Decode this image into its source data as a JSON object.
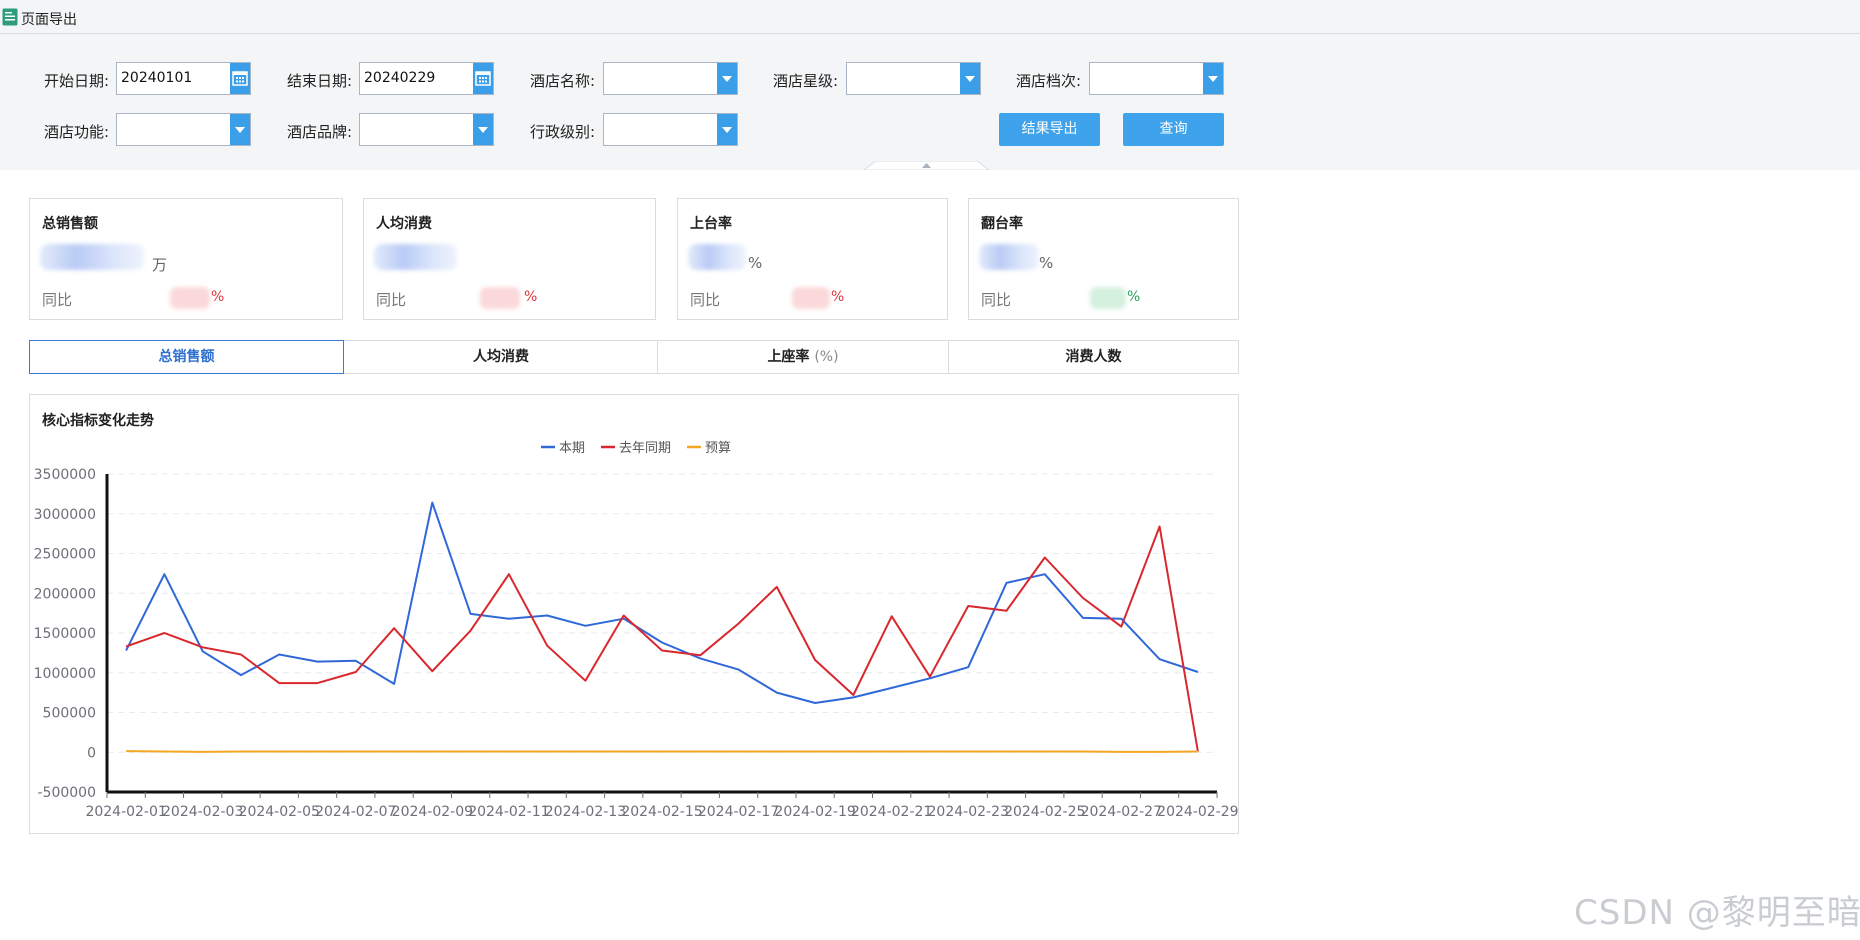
{
  "window": {
    "title": "页面导出"
  },
  "filters": {
    "start_date": {
      "label": "开始日期:",
      "value": "20240101"
    },
    "end_date": {
      "label": "结束日期:",
      "value": "20240229"
    },
    "hotel_name": {
      "label": "酒店名称:",
      "value": ""
    },
    "hotel_star": {
      "label": "酒店星级:",
      "value": ""
    },
    "hotel_grade": {
      "label": "酒店档次:",
      "value": ""
    },
    "hotel_function": {
      "label": "酒店功能:",
      "value": ""
    },
    "hotel_brand": {
      "label": "酒店品牌:",
      "value": ""
    },
    "admin_level": {
      "label": "行政级别:",
      "value": ""
    }
  },
  "actions": {
    "export_label": "结果导出",
    "query_label": "查询"
  },
  "cards": [
    {
      "title": "总销售额",
      "unit": "万",
      "yoy_label": "同比",
      "pct": "%",
      "trend_color": "#d9363e"
    },
    {
      "title": "人均消费",
      "unit": "",
      "yoy_label": "同比",
      "pct": "%",
      "trend_color": "#d9363e"
    },
    {
      "title": "上台率",
      "unit": "%",
      "yoy_label": "同比",
      "pct": "%",
      "trend_color": "#d9363e"
    },
    {
      "title": "翻台率",
      "unit": "%",
      "yoy_label": "同比",
      "pct": "%",
      "trend_color": "#27a55a"
    }
  ],
  "tabs": [
    {
      "label": "总销售额",
      "suffix": ""
    },
    {
      "label": "人均消费",
      "suffix": ""
    },
    {
      "label": "上座率",
      "suffix": "(%)"
    },
    {
      "label": "消费人数",
      "suffix": ""
    }
  ],
  "chart_title": "核心指标变化走势",
  "watermark": "CSDN @黎明至暗",
  "colors": {
    "accent": "#3ea3ec",
    "series_current": "#2f68d8",
    "series_last_year": "#d9272e",
    "series_budget": "#f5a623"
  },
  "chart_data": {
    "type": "line",
    "x": [
      "2024-02-01",
      "2024-02-02",
      "2024-02-03",
      "2024-02-04",
      "2024-02-05",
      "2024-02-06",
      "2024-02-07",
      "2024-02-08",
      "2024-02-09",
      "2024-02-10",
      "2024-02-11",
      "2024-02-12",
      "2024-02-13",
      "2024-02-14",
      "2024-02-15",
      "2024-02-16",
      "2024-02-17",
      "2024-02-18",
      "2024-02-19",
      "2024-02-20",
      "2024-02-21",
      "2024-02-22",
      "2024-02-23",
      "2024-02-24",
      "2024-02-25",
      "2024-02-26",
      "2024-02-27",
      "2024-02-28",
      "2024-02-29"
    ],
    "x_tick_labels": [
      "2024-02-01",
      "2024-02-03",
      "2024-02-05",
      "2024-02-07",
      "2024-02-09",
      "2024-02-11",
      "2024-02-13",
      "2024-02-15",
      "2024-02-17",
      "2024-02-19",
      "2024-02-21",
      "2024-02-23",
      "2024-02-25",
      "2024-02-27",
      "2024-02-29"
    ],
    "ylim": [
      -500000,
      3500000
    ],
    "y_ticks": [
      -500000,
      0,
      500000,
      1000000,
      1500000,
      2000000,
      2500000,
      3000000,
      3500000
    ],
    "legend_position": "top-center",
    "grid": true,
    "series": [
      {
        "name": "本期",
        "color": "#2f68d8",
        "values": [
          1280000,
          2240000,
          1270000,
          970000,
          1230000,
          1140000,
          1150000,
          860000,
          3140000,
          1740000,
          1680000,
          1720000,
          1590000,
          1680000,
          1380000,
          1180000,
          1040000,
          750000,
          620000,
          690000,
          810000,
          930000,
          1070000,
          2130000,
          2240000,
          1690000,
          1680000,
          1170000,
          1010000
        ]
      },
      {
        "name": "去年同期",
        "color": "#d9272e",
        "values": [
          1330000,
          1500000,
          1320000,
          1230000,
          870000,
          870000,
          1010000,
          1560000,
          1020000,
          1530000,
          2240000,
          1340000,
          900000,
          1720000,
          1280000,
          1220000,
          1620000,
          2080000,
          1160000,
          720000,
          1710000,
          950000,
          1840000,
          1780000,
          2450000,
          1940000,
          1580000,
          2840000,
          10000
        ]
      },
      {
        "name": "预算",
        "color": "#f5a623",
        "values": [
          15000,
          10000,
          5000,
          10000,
          10000,
          10000,
          10000,
          10000,
          10000,
          10000,
          10000,
          10000,
          10000,
          10000,
          10000,
          10000,
          10000,
          10000,
          10000,
          10000,
          10000,
          10000,
          10000,
          10000,
          10000,
          10000,
          5000,
          5000,
          10000
        ]
      }
    ]
  }
}
